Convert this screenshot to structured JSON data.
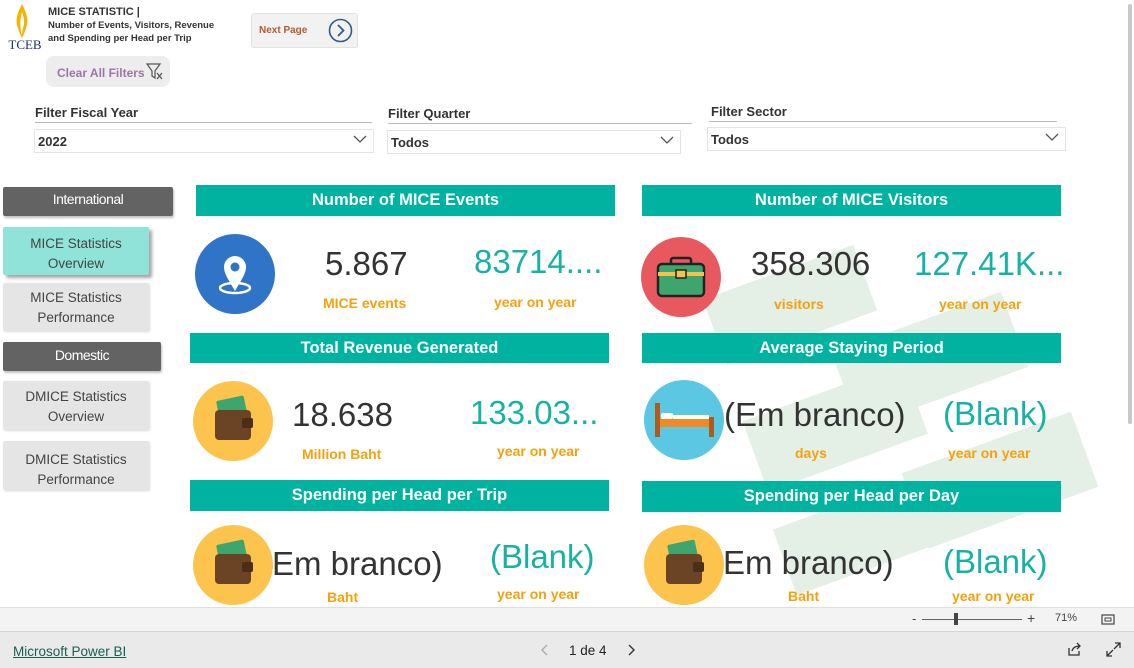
{
  "header": {
    "logo_text": "TCEB",
    "title_line1": "MICE STATISTIC |",
    "title_line2": "Number of Events, Visitors, Revenue",
    "title_line3": "and Spending per Head per Trip",
    "next_page_label": "Next Page",
    "clear_filters_label": "Clear All Filters"
  },
  "filters": {
    "fiscal_year": {
      "label": "Filter Fiscal Year",
      "value": "2022"
    },
    "quarter": {
      "label": "Filter Quarter",
      "value": "Todos"
    },
    "sector": {
      "label": "Filter Sector",
      "value": "Todos"
    }
  },
  "nav": {
    "international_label": "International",
    "mice_overview": [
      "MICE Statistics",
      "Overview"
    ],
    "mice_performance": [
      "MICE Statistics",
      "Performance"
    ],
    "domestic_label": "Domestic",
    "dmice_overview": [
      "DMICE Statistics",
      "Overview"
    ],
    "dmice_performance": [
      "DMICE Statistics",
      "Performance"
    ]
  },
  "cards": {
    "events": {
      "title": "Number of MICE Events",
      "value": "5.867",
      "unit": "MICE events",
      "yoy": "83714....",
      "yoy_label": "year on year",
      "icon": "location-pin-icon"
    },
    "visitors": {
      "title": "Number of MICE Visitors",
      "value": "358.306",
      "unit": "visitors",
      "yoy": "127.41K...",
      "yoy_label": "year on year",
      "icon": "briefcase-icon"
    },
    "revenue": {
      "title": "Total Revenue Generated",
      "value": "18.638",
      "unit": "Million Baht",
      "yoy": "133.03...",
      "yoy_label": "year on year",
      "icon": "wallet-icon"
    },
    "staying": {
      "title": "Average Staying Period",
      "value": "(Em branco)",
      "unit": "days",
      "yoy": "(Blank)",
      "yoy_label": "year on year",
      "icon": "bed-icon"
    },
    "spend_trip": {
      "title": "Spending per Head per Trip",
      "value": "Em branco)",
      "unit": "Baht",
      "yoy": "(Blank)",
      "yoy_label": "year on year",
      "icon": "wallet-icon"
    },
    "spend_day": {
      "title": "Spending per Head per Day",
      "value": "Em branco)",
      "unit": "Baht",
      "yoy": "(Blank)",
      "yoy_label": "year on year",
      "icon": "wallet-icon"
    }
  },
  "zoom": {
    "minus": "-",
    "plus": "+",
    "percent": "71%"
  },
  "footer": {
    "link": "Microsoft Power BI",
    "page_indicator": "1 de 4"
  },
  "colors": {
    "teal": "#00b3a1",
    "orange": "#f5a10d",
    "yoy_teal": "#17b2a4",
    "nav_gray": "#636363",
    "nav_active": "#8fe3d9"
  }
}
